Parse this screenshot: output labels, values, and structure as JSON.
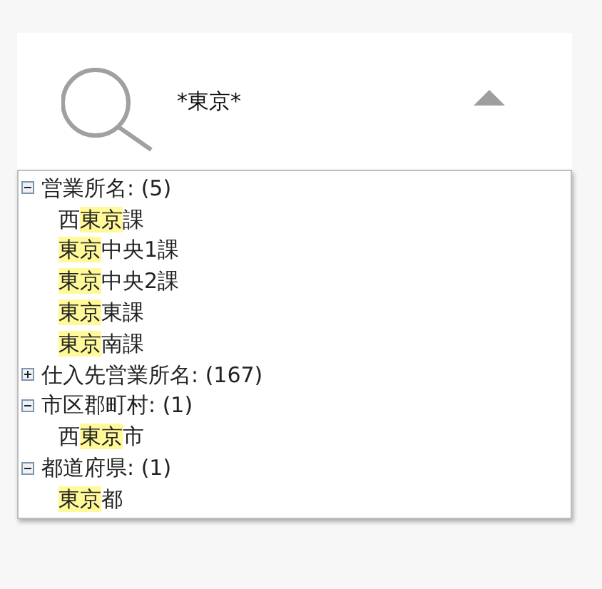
{
  "search": {
    "value": "*東京*"
  },
  "groups": [
    {
      "label": "営業所名: (5)",
      "expanded": true,
      "children": [
        [
          {
            "text": "西",
            "match": false
          },
          {
            "text": "東京",
            "match": true
          },
          {
            "text": "課",
            "match": false
          }
        ],
        [
          {
            "text": "東京",
            "match": true
          },
          {
            "text": "中央1課",
            "match": false
          }
        ],
        [
          {
            "text": "東京",
            "match": true
          },
          {
            "text": "中央2課",
            "match": false
          }
        ],
        [
          {
            "text": "東京",
            "match": true
          },
          {
            "text": "東課",
            "match": false
          }
        ],
        [
          {
            "text": "東京",
            "match": true
          },
          {
            "text": "南課",
            "match": false
          }
        ]
      ]
    },
    {
      "label": "仕入先営業所名: (167)",
      "expanded": false
    },
    {
      "label": "市区郡町村: (1)",
      "expanded": true,
      "children": [
        [
          {
            "text": "西",
            "match": false
          },
          {
            "text": "東京",
            "match": true
          },
          {
            "text": "市",
            "match": false
          }
        ]
      ]
    },
    {
      "label": "都道府県: (1)",
      "expanded": true,
      "children": [
        [
          {
            "text": "東京",
            "match": true
          },
          {
            "text": "都",
            "match": false
          }
        ]
      ]
    }
  ]
}
